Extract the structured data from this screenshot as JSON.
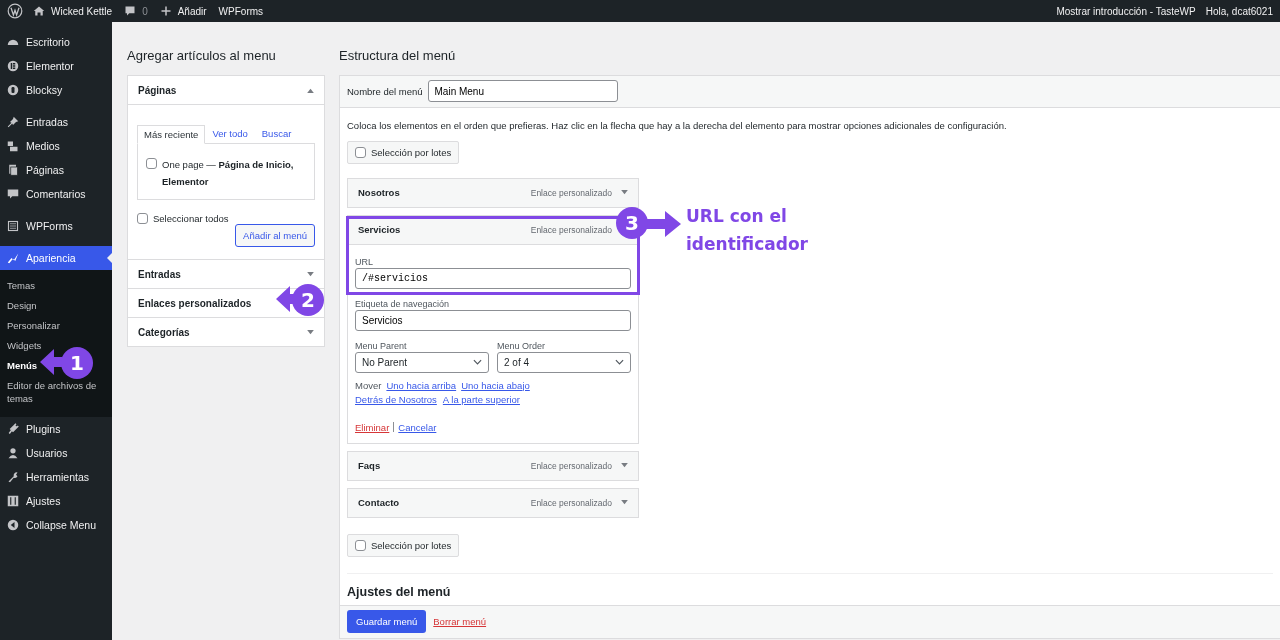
{
  "admin_bar": {
    "site": "Wicked Kettle",
    "comments": "0",
    "new": "Añadir",
    "plugin": "WPForms",
    "right": [
      "Mostrar introducción - TasteWP",
      "Hola, dcat6021"
    ]
  },
  "sidebar": {
    "groups": [
      [
        {
          "label": "Escritorio",
          "selected": false
        },
        {
          "label": "Elementor",
          "selected": false
        },
        {
          "label": "Blocksy",
          "selected": false
        }
      ],
      [
        {
          "label": "Entradas",
          "selected": false
        },
        {
          "label": "Medios",
          "selected": false
        },
        {
          "label": "Páginas",
          "selected": false
        },
        {
          "label": "Comentarios",
          "selected": false
        }
      ],
      [
        {
          "label": "WPForms",
          "selected": false
        }
      ],
      [
        {
          "label": "Apariencia",
          "selected": true,
          "children": [
            {
              "label": "Temas",
              "selected": false
            },
            {
              "label": "Design",
              "selected": false
            },
            {
              "label": "Personalizar",
              "selected": false
            },
            {
              "label": "Widgets",
              "selected": false
            },
            {
              "label": "Menús",
              "selected": true
            },
            {
              "label": "Editor de archivos de temas",
              "selected": false
            }
          ]
        },
        {
          "label": "Plugins",
          "selected": false
        },
        {
          "label": "Usuarios",
          "selected": false
        },
        {
          "label": "Herramientas",
          "selected": false
        },
        {
          "label": "Ajustes",
          "selected": false
        },
        {
          "label": "Collapse Menu",
          "selected": false
        }
      ]
    ]
  },
  "add_items": {
    "title": "Agregar artículos al menu",
    "sections": [
      {
        "title": "Páginas",
        "expanded": true,
        "tabs": [
          {
            "label": "Más reciente",
            "selected": true
          },
          {
            "label": "Ver todo",
            "selected": false
          },
          {
            "label": "Buscar",
            "selected": false
          }
        ],
        "items": [
          {
            "label": "One page — **Página de Inicio, Elementor**",
            "checked": false
          }
        ],
        "select_all": {
          "label": "Seleccionar todos",
          "checked": false
        },
        "button": "Añadir al menú"
      },
      {
        "title": "Entradas",
        "expanded": false
      },
      {
        "title": "Enlaces personalizados",
        "expanded": false
      },
      {
        "title": "Categorías",
        "expanded": false
      }
    ]
  },
  "structure": {
    "title": "Estructura del menú",
    "menu_name": {
      "label": "Nombre del menú",
      "value": "Main Menu"
    },
    "instructions": "Coloca los elementos en el orden que prefieras. Haz clic en la flecha que hay a la derecha del elemento para mostrar opciones adicionales de configuración.",
    "bulk_select_top": {
      "label": "Selección por lotes",
      "checked": false
    },
    "menu_items": [
      {
        "title": "Nosotros",
        "type": "Enlace personalizado",
        "expanded": false
      },
      {
        "title": "Servicios",
        "type": "Enlace personalizado",
        "expanded": true,
        "url_label": "URL",
        "url": "/#servicios",
        "nav_label_label": "Etiqueta de navegación",
        "nav_label": "Servicios",
        "parent_label": "Menu Parent",
        "parent": "No Parent",
        "order_label": "Menu Order",
        "order": "2 of 4",
        "move_label": "Mover",
        "move_links": [
          "Uno hacia arriba",
          "Uno hacia abajo",
          "Detrás de Nosotros",
          "A la parte superior"
        ],
        "delete": "Eliminar",
        "cancel": "Cancelar"
      },
      {
        "title": "Faqs",
        "type": "Enlace personalizado",
        "expanded": false
      },
      {
        "title": "Contacto",
        "type": "Enlace personalizado",
        "expanded": false
      }
    ],
    "bulk_select_bottom": {
      "label": "Selección por lotes",
      "checked": false
    },
    "settings_title": "Ajustes del menú",
    "save_button": "Guardar menú",
    "delete_link": "Borrar menú"
  },
  "annotations": [
    {
      "number": "1"
    },
    {
      "number": "2"
    },
    {
      "number": "3",
      "text": "URL con el identificador"
    }
  ]
}
